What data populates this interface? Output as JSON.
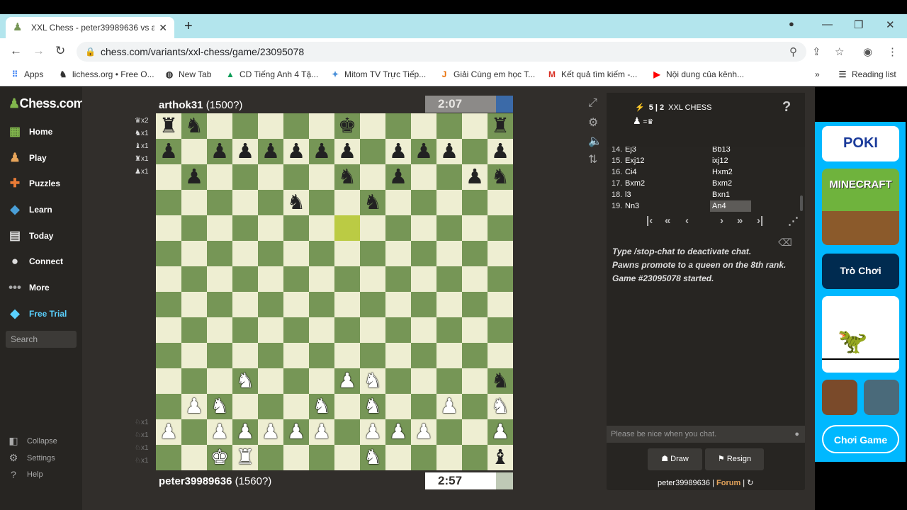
{
  "browser": {
    "tab_title": "XXL Chess - peter39989636 vs ar",
    "url": "chess.com/variants/xxl-chess/game/23095078",
    "bookmarks": [
      {
        "icon": "apps-icon",
        "label": "Apps"
      },
      {
        "icon": "lichess-icon",
        "label": "lichess.org • Free O..."
      },
      {
        "icon": "globe-icon",
        "label": "New Tab"
      },
      {
        "icon": "drive-icon",
        "label": "CD Tiếng Anh 4 Tậ..."
      },
      {
        "icon": "bird-icon",
        "label": "Mitom TV Trực Tiếp..."
      },
      {
        "icon": "j-icon",
        "label": "Giải Cùng em học T..."
      },
      {
        "icon": "gmail-icon",
        "label": "Kết quả tìm kiếm -..."
      },
      {
        "icon": "youtube-icon",
        "label": "Nội dung của kênh..."
      }
    ],
    "reading_list": "Reading list"
  },
  "sidebar": {
    "logo": "Chess.com",
    "items": [
      {
        "icon": "home-icon",
        "label": "Home"
      },
      {
        "icon": "play-icon",
        "label": "Play"
      },
      {
        "icon": "puzzles-icon",
        "label": "Puzzles"
      },
      {
        "icon": "learn-icon",
        "label": "Learn"
      },
      {
        "icon": "today-icon",
        "label": "Today"
      },
      {
        "icon": "connect-icon",
        "label": "Connect"
      },
      {
        "icon": "more-icon",
        "label": "More"
      },
      {
        "icon": "diamond-icon",
        "label": "Free Trial"
      }
    ],
    "search_placeholder": "Search",
    "footer": [
      {
        "icon": "collapse-icon",
        "label": "Collapse"
      },
      {
        "icon": "settings-icon",
        "label": "Settings"
      },
      {
        "icon": "help-icon",
        "label": "Help"
      }
    ]
  },
  "game": {
    "top_player": "arthok31",
    "top_rating": "(1500?)",
    "top_clock": "2:07",
    "bottom_player": "peter39989636",
    "bottom_rating": "(1560?)",
    "bottom_clock": "2:57",
    "top_captures": [
      "♛x2",
      "♞x1",
      "♝x1",
      "♜x1",
      "♟x1"
    ],
    "bottom_captures": [
      "♘x1",
      "♘x1",
      "♘x1",
      "♘x1"
    ],
    "board": [
      [
        "bR",
        "bN",
        "",
        "",
        "",
        "",
        "",
        "bK",
        "",
        "",
        "",
        "",
        "",
        "bR"
      ],
      [
        "bP",
        "",
        "bP",
        "bP",
        "bP",
        "bP",
        "bP",
        "bP",
        "",
        "bP",
        "bP",
        "bP",
        "",
        "bP"
      ],
      [
        "",
        "bP",
        "",
        "",
        "",
        "",
        "",
        "bN",
        "",
        "bP",
        "",
        "",
        "bP",
        "bN"
      ],
      [
        "",
        "",
        "",
        "",
        "",
        "bN",
        "",
        "",
        "bN",
        "",
        "",
        "",
        "",
        ""
      ],
      [
        "",
        "",
        "",
        "",
        "",
        "",
        "",
        "",
        "",
        "",
        "",
        "",
        "",
        ""
      ],
      [
        "",
        "",
        "",
        "",
        "",
        "",
        "",
        "",
        "",
        "",
        "",
        "",
        "",
        ""
      ],
      [
        "",
        "",
        "",
        "",
        "",
        "",
        "",
        "",
        "",
        "",
        "",
        "",
        "",
        ""
      ],
      [
        "",
        "",
        "",
        "",
        "",
        "",
        "",
        "",
        "",
        "",
        "",
        "",
        "",
        ""
      ],
      [
        "",
        "",
        "",
        "",
        "",
        "",
        "",
        "",
        "",
        "",
        "",
        "",
        "",
        ""
      ],
      [
        "",
        "",
        "",
        "",
        "",
        "",
        "",
        "",
        "",
        "",
        "",
        "",
        "",
        ""
      ],
      [
        "",
        "",
        "",
        "wN",
        "",
        "",
        "",
        "wP",
        "wN",
        "",
        "",
        "",
        "",
        "bN"
      ],
      [
        "",
        "wP",
        "wN",
        "",
        "",
        "",
        "wN",
        "",
        "wN",
        "",
        "",
        "wP",
        "",
        "wN"
      ],
      [
        "wP",
        "",
        "wP",
        "wP",
        "wP",
        "wP",
        "wP",
        "",
        "wP",
        "wP",
        "wP",
        "",
        "",
        "wP"
      ],
      [
        "",
        "",
        "wK",
        "wR",
        "",
        "",
        "",
        "",
        "wN",
        "",
        "",
        "",
        "",
        "bB"
      ]
    ],
    "highlight": [
      4,
      7
    ]
  },
  "panel": {
    "time_control": "5 | 2",
    "variant": "XXL CHESS",
    "variant_sub": "=♛",
    "help": "?",
    "moves": [
      {
        "num": "14.",
        "white": "Ej3",
        "black": "Bb13"
      },
      {
        "num": "15.",
        "white": "Exj12",
        "black": "ixj12"
      },
      {
        "num": "16.",
        "white": "Ci4",
        "black": "Hxm2"
      },
      {
        "num": "17.",
        "white": "Bxm2",
        "black": "Bxm2"
      },
      {
        "num": "18.",
        "white": "l3",
        "black": "Bxn1"
      },
      {
        "num": "19.",
        "white": "Nn3",
        "black": "An4"
      }
    ],
    "chat_lines": [
      "Type /stop-chat to deactivate chat.",
      "Pawns promote to a queen on the 8th rank.",
      "Game #23095078 started."
    ],
    "chat_placeholder": "Please be nice when you chat.",
    "draw": "Draw",
    "resign": "Resign",
    "footer_user": "peter39989636",
    "footer_sep": "|",
    "footer_forum": "Forum",
    "footer_sep2": "|"
  },
  "ads": {
    "logo": "POKI",
    "minecraft": "MINECRAFT",
    "tro_choi": "Trò Chơi",
    "choi_game": "Chơi Game"
  }
}
